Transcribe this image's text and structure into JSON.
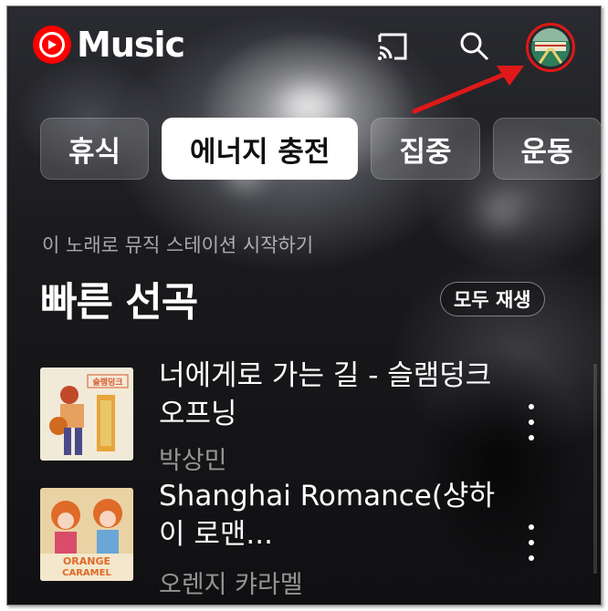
{
  "app": {
    "logo_text": "Music"
  },
  "header": {
    "cast_icon": "cast-icon",
    "search_icon": "search-icon",
    "avatar_icon": "profile-avatar-icon"
  },
  "chips": [
    {
      "label": "휴식",
      "selected": false
    },
    {
      "label": "에너지 충전",
      "selected": true
    },
    {
      "label": "집중",
      "selected": false
    },
    {
      "label": "운동",
      "selected": false
    }
  ],
  "section": {
    "subtitle": "이 노래로 뮤직 스테이션 시작하기",
    "title": "빠른 선곡",
    "play_all_label": "모두 재생"
  },
  "songs": [
    {
      "title": "너에게로 가는 길 - 슬램덩크 오프닝",
      "artist": "박상민",
      "thumb_text": "슬램덩크"
    },
    {
      "title": "Shanghai Romance(샹하이 로맨...",
      "artist": "오렌지 캬라멜",
      "thumb_text_1": "ORANGE",
      "thumb_text_2": "CARAMEL"
    }
  ],
  "colors": {
    "accent": "#ff0000",
    "highlight_ring": "#e01818",
    "selected_chip": "#ffffff"
  }
}
